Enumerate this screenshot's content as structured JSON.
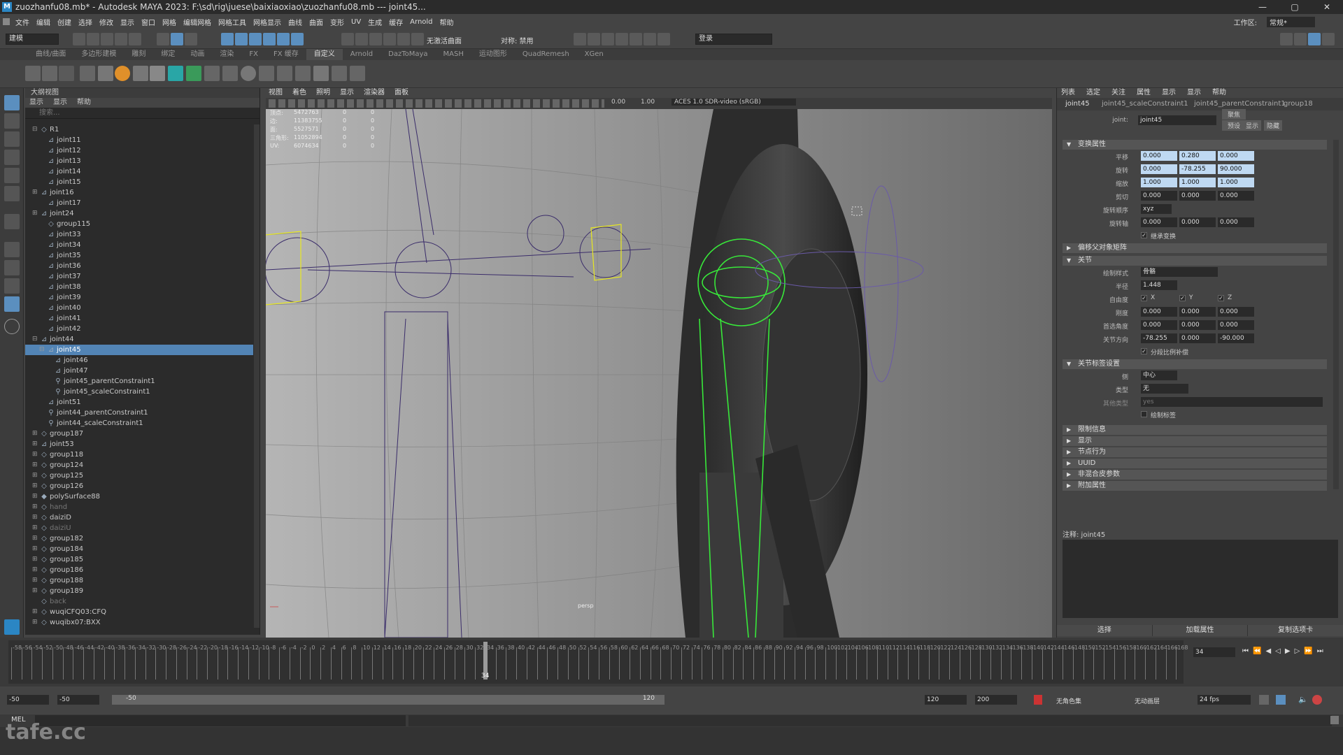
{
  "window": {
    "title": "zuozhanfu08.mb* - Autodesk MAYA 2023: F:\\sd\\rig\\juese\\baixiaoxiao\\zuozhanfu08.mb   ---   joint45...",
    "app_icon_label": "M",
    "minimize": "—",
    "maximize": "▢",
    "close": "✕"
  },
  "menubar": {
    "items": [
      "文件",
      "编辑",
      "创建",
      "选择",
      "修改",
      "显示",
      "窗口",
      "网格",
      "编辑网格",
      "网格工具",
      "网格显示",
      "曲线",
      "曲面",
      "变形",
      "UV",
      "生成",
      "缓存",
      "Arnold",
      "帮助"
    ],
    "workspace_label": "工作区:",
    "workspace_value": "常规*"
  },
  "statusline": {
    "mode_dropdown": "建模",
    "surface_label": "无激活曲面",
    "symmetry_label": "对称: 禁用",
    "login_label": "登录"
  },
  "shelf_tabs": {
    "items": [
      "曲线/曲面",
      "多边形建模",
      "雕刻",
      "绑定",
      "动画",
      "渲染",
      "FX",
      "FX 缓存",
      "自定义",
      "Arnold",
      "DazToMaya",
      "MASH",
      "运动图形",
      "QuadRemesh",
      "XGen"
    ],
    "active_index": 8
  },
  "outliner": {
    "header": "大纲视图",
    "menu": [
      "显示",
      "显示",
      "帮助"
    ],
    "search_placeholder": "搜索...",
    "rows": [
      {
        "label": "R1",
        "indent": 1,
        "expand": "⊟",
        "icon": "◇"
      },
      {
        "label": "joint11",
        "indent": 2,
        "icon": "⊿"
      },
      {
        "label": "joint12",
        "indent": 2,
        "icon": "⊿"
      },
      {
        "label": "joint13",
        "indent": 2,
        "icon": "⊿"
      },
      {
        "label": "joint14",
        "indent": 2,
        "icon": "⊿"
      },
      {
        "label": "joint15",
        "indent": 2,
        "icon": "⊿"
      },
      {
        "label": "joint16",
        "indent": 1,
        "expand": "⊞",
        "icon": "⊿"
      },
      {
        "label": "joint17",
        "indent": 2,
        "icon": "⊿"
      },
      {
        "label": "joint24",
        "indent": 1,
        "expand": "⊞",
        "icon": "⊿"
      },
      {
        "label": "group115",
        "indent": 2,
        "icon": "◇"
      },
      {
        "label": "joint33",
        "indent": 2,
        "icon": "⊿"
      },
      {
        "label": "joint34",
        "indent": 2,
        "icon": "⊿"
      },
      {
        "label": "joint35",
        "indent": 2,
        "icon": "⊿"
      },
      {
        "label": "joint36",
        "indent": 2,
        "icon": "⊿"
      },
      {
        "label": "joint37",
        "indent": 2,
        "icon": "⊿"
      },
      {
        "label": "joint38",
        "indent": 2,
        "icon": "⊿"
      },
      {
        "label": "joint39",
        "indent": 2,
        "icon": "⊿"
      },
      {
        "label": "joint40",
        "indent": 2,
        "icon": "⊿"
      },
      {
        "label": "joint41",
        "indent": 2,
        "icon": "⊿"
      },
      {
        "label": "joint42",
        "indent": 2,
        "icon": "⊿"
      },
      {
        "label": "joint44",
        "indent": 1,
        "expand": "⊟",
        "icon": "⊿"
      },
      {
        "label": "joint45",
        "indent": 2,
        "expand": "⊟",
        "icon": "⊿",
        "selected": true
      },
      {
        "label": "joint46",
        "indent": 3,
        "icon": "⊿"
      },
      {
        "label": "joint47",
        "indent": 3,
        "icon": "⊿"
      },
      {
        "label": "joint45_parentConstraint1",
        "indent": 3,
        "icon": "⚲"
      },
      {
        "label": "joint45_scaleConstraint1",
        "indent": 3,
        "icon": "⚲"
      },
      {
        "label": "joint51",
        "indent": 2,
        "icon": "⊿"
      },
      {
        "label": "joint44_parentConstraint1",
        "indent": 2,
        "icon": "⚲"
      },
      {
        "label": "joint44_scaleConstraint1",
        "indent": 2,
        "icon": "⚲"
      },
      {
        "label": "group187",
        "indent": 1,
        "expand": "⊞",
        "icon": "◇"
      },
      {
        "label": "joint53",
        "indent": 1,
        "expand": "⊞",
        "icon": "⊿"
      },
      {
        "label": "group118",
        "indent": 1,
        "expand": "⊞",
        "icon": "◇"
      },
      {
        "label": "group124",
        "indent": 1,
        "expand": "⊞",
        "icon": "◇"
      },
      {
        "label": "group125",
        "indent": 1,
        "expand": "⊞",
        "icon": "◇"
      },
      {
        "label": "group126",
        "indent": 1,
        "expand": "⊞",
        "icon": "◇"
      },
      {
        "label": "polySurface88",
        "indent": 1,
        "expand": "⊞",
        "icon": "◆"
      },
      {
        "label": "hand",
        "indent": 1,
        "expand": "⊞",
        "icon": "◇",
        "dim": true
      },
      {
        "label": "daiziD",
        "indent": 1,
        "expand": "⊞",
        "icon": "◇"
      },
      {
        "label": "daiziU",
        "indent": 1,
        "expand": "⊞",
        "icon": "◇",
        "dim": true
      },
      {
        "label": "group182",
        "indent": 1,
        "expand": "⊞",
        "icon": "◇"
      },
      {
        "label": "group184",
        "indent": 1,
        "expand": "⊞",
        "icon": "◇"
      },
      {
        "label": "group185",
        "indent": 1,
        "expand": "⊞",
        "icon": "◇"
      },
      {
        "label": "group186",
        "indent": 1,
        "expand": "⊞",
        "icon": "◇"
      },
      {
        "label": "group188",
        "indent": 1,
        "expand": "⊞",
        "icon": "◇"
      },
      {
        "label": "group189",
        "indent": 1,
        "expand": "⊞",
        "icon": "◇"
      },
      {
        "label": "back",
        "indent": 1,
        "icon": "◇",
        "dim": true
      },
      {
        "label": "wuqiCFQ03:CFQ",
        "indent": 1,
        "expand": "⊞",
        "icon": "◇"
      },
      {
        "label": "wuqibx07:BXX",
        "indent": 1,
        "expand": "⊞",
        "icon": "◇"
      }
    ]
  },
  "viewport": {
    "menu": [
      "视图",
      "着色",
      "照明",
      "显示",
      "渲染器",
      "面板"
    ],
    "exposure": "0.00",
    "gamma": "1.00",
    "color_space": "ACES 1.0 SDR-video (sRGB)",
    "camera_label": "persp",
    "hud": {
      "rows": [
        {
          "name": "顶点:",
          "a": "5472763",
          "b": "0",
          "c": "0"
        },
        {
          "name": "边:",
          "a": "11383755",
          "b": "0",
          "c": "0"
        },
        {
          "name": "面:",
          "a": "5527571",
          "b": "0",
          "c": "0"
        },
        {
          "name": "三角形:",
          "a": "11052894",
          "b": "0",
          "c": "0"
        },
        {
          "name": "UV:",
          "a": "6074634",
          "b": "0",
          "c": "0"
        }
      ]
    }
  },
  "attribute_editor": {
    "menu": [
      "列表",
      "选定",
      "关注",
      "属性",
      "显示",
      "显示",
      "帮助"
    ],
    "tabs": [
      "joint45",
      "joint45_scaleConstraint1",
      "joint45_parentConstraint1",
      "group18"
    ],
    "node_label": "joint:",
    "node_name": "joint45",
    "focus_btn": "聚焦",
    "preset_btn": "预设",
    "show_btn": "显示",
    "hide_btn": "隐藏",
    "sections": {
      "transform": "变换属性",
      "pivots": "偏移父对象矩阵",
      "joint": "关节",
      "joint_label": "关节标签设置",
      "limit": "限制信息",
      "display": "显示",
      "node_behavior": "节点行为",
      "uuid": "UUID",
      "extra": "非混合皮参数",
      "extra2": "附加属性"
    },
    "transform": {
      "translate_label": "平移",
      "translate": [
        "0.000",
        "0.280",
        "0.000"
      ],
      "rotate_label": "旋转",
      "rotate": [
        "0.000",
        "-78.255",
        "90.000"
      ],
      "scale_label": "缩放",
      "scale": [
        "1.000",
        "1.000",
        "1.000"
      ],
      "shear_label": "剪切",
      "shear": [
        "0.000",
        "0.000",
        "0.000"
      ],
      "rotate_order_label": "旋转顺序",
      "rotate_order": "xyz",
      "rotate_axis_label": "旋转轴",
      "rotate_axis": [
        "0.000",
        "0.000",
        "0.000"
      ],
      "inherit_label": "继承变换"
    },
    "joint": {
      "draw_style_label": "绘制样式",
      "draw_style": "骨骼",
      "radius_label": "半径",
      "radius": "1.448",
      "dof_label": "自由度",
      "dof": [
        "X",
        "Y",
        "Z"
      ],
      "stiffness_label": "刚度",
      "stiffness": [
        "0.000",
        "0.000",
        "0.000"
      ],
      "preferred_label": "首选角度",
      "preferred": [
        "0.000",
        "0.000",
        "0.000"
      ],
      "orient_label": "关节方向",
      "orient": [
        "-78.255",
        "0.000",
        "-90.000"
      ],
      "segment_label": "分段比例补偿"
    },
    "joint_label": {
      "side_label": "侧",
      "side": "中心",
      "type_label": "类型",
      "type": "无",
      "other_label": "其他类型",
      "other": "yes",
      "draw_label": "绘制标签"
    },
    "notes_label": "注释: joint45",
    "bottom": [
      "选择",
      "加载属性",
      "复制选项卡"
    ]
  },
  "timeline": {
    "ticks": [
      "-58",
      "-56",
      "-54",
      "-52",
      "-50",
      "-48",
      "-46",
      "-44",
      "-42",
      "-40",
      "-38",
      "-36",
      "-34",
      "-32",
      "-30",
      "-28",
      "-26",
      "-24",
      "-22",
      "-20",
      "-18",
      "-16",
      "-14",
      "-12",
      "-10",
      "-8",
      "-6",
      "-4",
      "-2",
      "0",
      "2",
      "4",
      "6",
      "8",
      "10",
      "12",
      "14",
      "16",
      "18",
      "20",
      "22",
      "24",
      "26",
      "28",
      "30",
      "32",
      "34",
      "36",
      "38",
      "40",
      "42",
      "44",
      "46",
      "48",
      "50",
      "52",
      "54",
      "56",
      "58",
      "60",
      "62",
      "64",
      "66",
      "68",
      "70",
      "72",
      "74",
      "76",
      "78",
      "80",
      "82",
      "84",
      "86",
      "88",
      "90",
      "92",
      "94",
      "96",
      "98",
      "100",
      "102",
      "104",
      "106",
      "108",
      "110",
      "112",
      "114",
      "116",
      "118",
      "120",
      "122",
      "124",
      "126",
      "128",
      "130",
      "132",
      "134",
      "136",
      "138",
      "140",
      "142",
      "144",
      "146",
      "148",
      "150",
      "152",
      "154",
      "156",
      "158",
      "160",
      "162",
      "164",
      "166",
      "168"
    ],
    "current_frame": "34",
    "current_frame_field": "34"
  },
  "range": {
    "start": "-50",
    "inner_start": "-50",
    "slider_start": "-50",
    "slider_end": "120",
    "inner_end": "120",
    "end": "200",
    "char_set": "无角色集",
    "anim_layer": "无动画层",
    "fps": "24 fps"
  },
  "cmdline": {
    "label": "MEL"
  },
  "watermark": "tafe.cc",
  "colors": {
    "accent": "#5284b5",
    "field_blue": "#bfd9f2"
  }
}
